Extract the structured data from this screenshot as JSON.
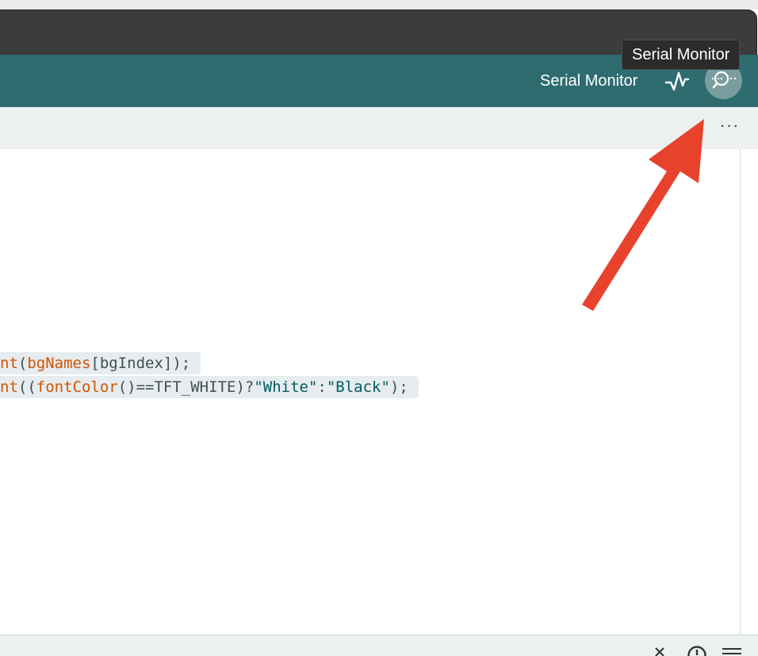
{
  "toolbar": {
    "serial_monitor_label": "Serial Monitor",
    "plotter_icon": "serial-plotter-icon",
    "monitor_icon": "serial-monitor-icon",
    "tooltip": "Serial Monitor",
    "background": "#2e6c70"
  },
  "tabbar": {
    "more_label": "···"
  },
  "editor": {
    "lines": [
      {
        "parts": [
          {
            "text": "nt",
            "kind": "fn"
          },
          {
            "text": "(",
            "kind": "plain"
          },
          {
            "text": "bgNames",
            "kind": "fn"
          },
          {
            "text": "[bgIndex]);",
            "kind": "plain"
          }
        ]
      },
      {
        "parts": [
          {
            "text": "nt",
            "kind": "fn"
          },
          {
            "text": "((",
            "kind": "plain"
          },
          {
            "text": "fontColor",
            "kind": "fn"
          },
          {
            "text": "()==TFT_WHITE)?",
            "kind": "plain"
          },
          {
            "text": "\"White\"",
            "kind": "str"
          },
          {
            "text": ":",
            "kind": "plain"
          },
          {
            "text": "\"Black\"",
            "kind": "str"
          },
          {
            "text": ");",
            "kind": "plain"
          }
        ]
      }
    ]
  },
  "annotation": {
    "arrow_color": "#e8412c"
  },
  "bottom_panel": {
    "close_icon": "close-icon",
    "clock_icon": "clock-icon",
    "menu_icon": "menu-icon"
  }
}
